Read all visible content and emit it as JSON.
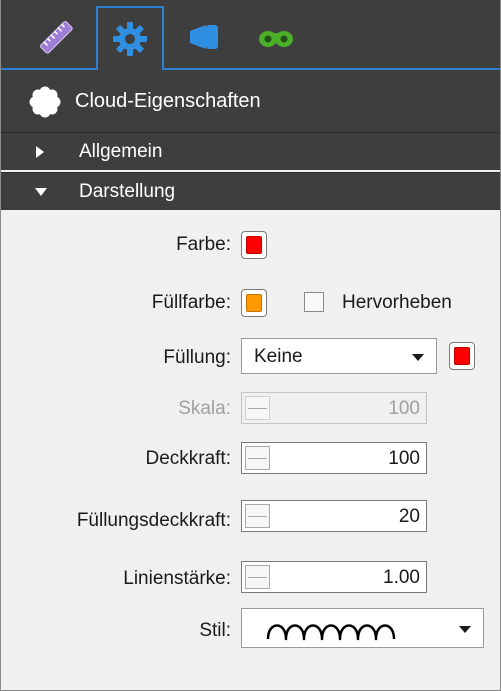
{
  "tabs": [
    {
      "icon": "ruler-icon",
      "label": "Messen"
    },
    {
      "icon": "gear-icon",
      "label": "Einstellungen",
      "active": true
    },
    {
      "icon": "callout-icon",
      "label": "Legende"
    },
    {
      "icon": "binoculars-icon",
      "label": "Suchen"
    }
  ],
  "title": "Cloud-Eigenschaften",
  "sections": {
    "allgemein": "Allgemein",
    "darstellung": "Darstellung"
  },
  "labels": {
    "farbe": "Farbe:",
    "fuellfarbe": "Füllfarbe:",
    "hervorheben": "Hervorheben",
    "fuellung": "Füllung:",
    "skala": "Skala:",
    "deckkraft": "Deckkraft:",
    "fuellungsdeckkraft": "Füllungsdeckkraft:",
    "linienstaerke": "Linienstärke:",
    "stil": "Stil:"
  },
  "values": {
    "fuellung": "Keine",
    "skala": "100",
    "deckkraft": "100",
    "fuellungsdeckkraft": "20",
    "linienstaerke": "1.00",
    "hervorheben_checked": false
  },
  "colors": {
    "farbe": "#ff0000",
    "fuellfarbe": "#ff9900",
    "fuellung": "#ff0000",
    "accent": "#2f7fd0",
    "header_bg": "#3e3e3e"
  }
}
